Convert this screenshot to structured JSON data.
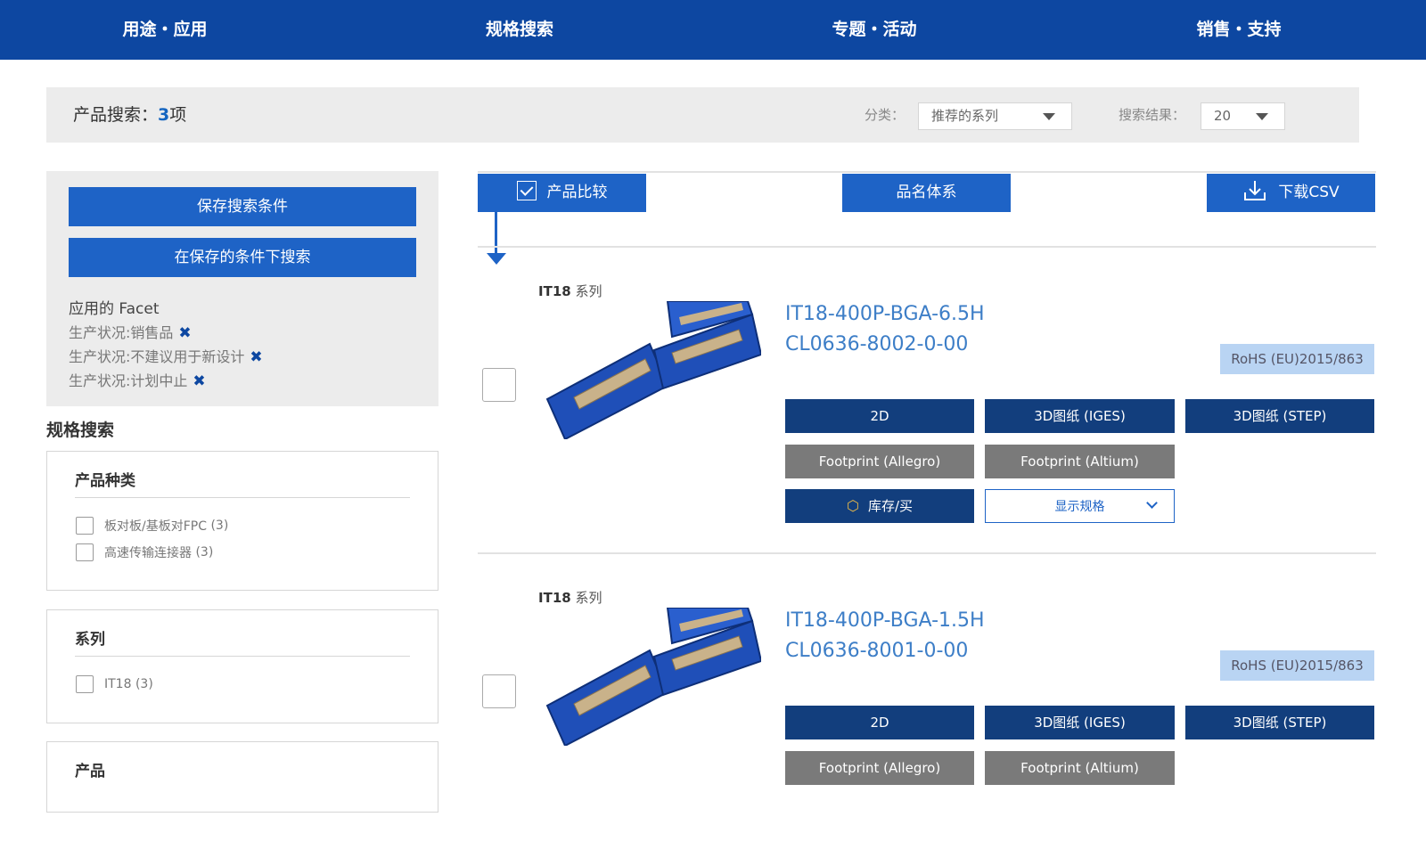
{
  "nav": {
    "items": [
      "用途・应用",
      "规格搜索",
      "专题・活动",
      "销售・支持"
    ]
  },
  "search": {
    "title_prefix": "产品搜索：",
    "count": "3",
    "count_suffix": "项",
    "category_label": "分类：",
    "category_value": "推荐的系列",
    "results_label": "搜索结果：",
    "results_value": "20"
  },
  "sidebar": {
    "save_button": "保存搜索条件",
    "search_saved_button": "在保存的条件下搜索",
    "applied_title": "应用的 Facet",
    "applied": [
      "生产状况:销售品",
      "生产状况:不建议用于新设计",
      "生产状况:计划中止"
    ],
    "remove_glyph": "✖",
    "spec_heading": "规格搜索",
    "panels": [
      {
        "title": "产品种类",
        "options": [
          {
            "label": "板对板/基板对FPC",
            "count": "(3)"
          },
          {
            "label": "高速传输连接器",
            "count": "(3)"
          }
        ]
      },
      {
        "title": "系列",
        "options": [
          {
            "label": "IT18",
            "count": "(3)"
          }
        ]
      },
      {
        "title": "产品",
        "options": []
      }
    ]
  },
  "toolbar": {
    "compare": "产品比较",
    "naming": "品名体系",
    "csv": "下载CSV"
  },
  "products": [
    {
      "series_bold": "IT18",
      "series_suffix": " 系列",
      "name": "IT18-400P-BGA-6.5H",
      "code": "CL0636-8002-0-00",
      "rohs": "RoHS (EU)2015/863",
      "btn_2d": "2D",
      "btn_iges": "3D图纸 (IGES)",
      "btn_step": "3D图纸 (STEP)",
      "btn_allegro": "Footprint (Allegro)",
      "btn_altium": "Footprint (Altium)",
      "btn_stock": "库存/买",
      "btn_specs": "显示规格"
    },
    {
      "series_bold": "IT18",
      "series_suffix": " 系列",
      "name": "IT18-400P-BGA-1.5H",
      "code": "CL0636-8001-0-00",
      "rohs": "RoHS (EU)2015/863",
      "btn_2d": "2D",
      "btn_iges": "3D图纸 (IGES)",
      "btn_step": "3D图纸 (STEP)",
      "btn_allegro": "Footprint (Allegro)",
      "btn_altium": "Footprint (Altium)"
    }
  ],
  "colors": {
    "nav_bg": "#0d47a1",
    "primary": "#1e63c6",
    "navy_button": "#123e7d",
    "gray_button": "#7a7a7a",
    "link": "#3d7ec7",
    "rohs_bg": "#b9d4f3"
  }
}
